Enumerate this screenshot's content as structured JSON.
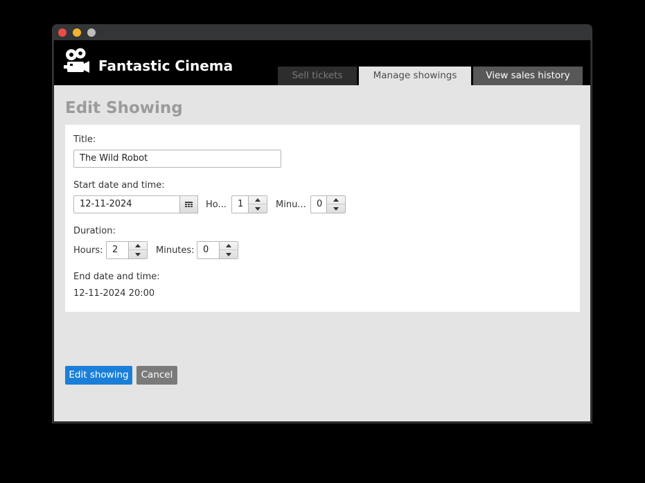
{
  "window": {
    "controls": {
      "close_color": "#ee4b47",
      "minimize_color": "#f3b22f",
      "maximize_color": "#bdbdbd"
    }
  },
  "header": {
    "app_title": "Fantastic Cinema",
    "logo_icon": "film-projector-icon",
    "tabs": [
      {
        "label": "Sell tickets",
        "state": "inactive",
        "color": "#7a7a7a"
      },
      {
        "label": "Manage showings",
        "state": "active",
        "color": "#4a4a4a"
      },
      {
        "label": "View sales history",
        "state": "inactive",
        "color": "#ffffff"
      }
    ]
  },
  "main": {
    "page_title": "Edit Showing",
    "form": {
      "title_label": "Title:",
      "title_value": "The Wild Robot",
      "start_label": "Start date and time:",
      "start_date": "12-11-2024",
      "calendar_icon": "calendar-icon",
      "hours_label_short": "Ho...",
      "start_hours": "1",
      "minutes_label_short": "Minu...",
      "start_minutes": "0",
      "duration_label": "Duration:",
      "duration_hours_label": "Hours:",
      "duration_hours": "2",
      "duration_minutes_label": "Minutes:",
      "duration_minutes": "0",
      "end_label": "End date and time:",
      "end_value": "12-11-2024 20:00"
    },
    "buttons": {
      "edit_label": "Edit showing",
      "cancel_label": "Cancel"
    }
  },
  "colors": {
    "primary": "#1a7fd8",
    "cancel": "#7a7a7a",
    "page_bg": "#e4e4e4",
    "header_bg": "#000000"
  }
}
